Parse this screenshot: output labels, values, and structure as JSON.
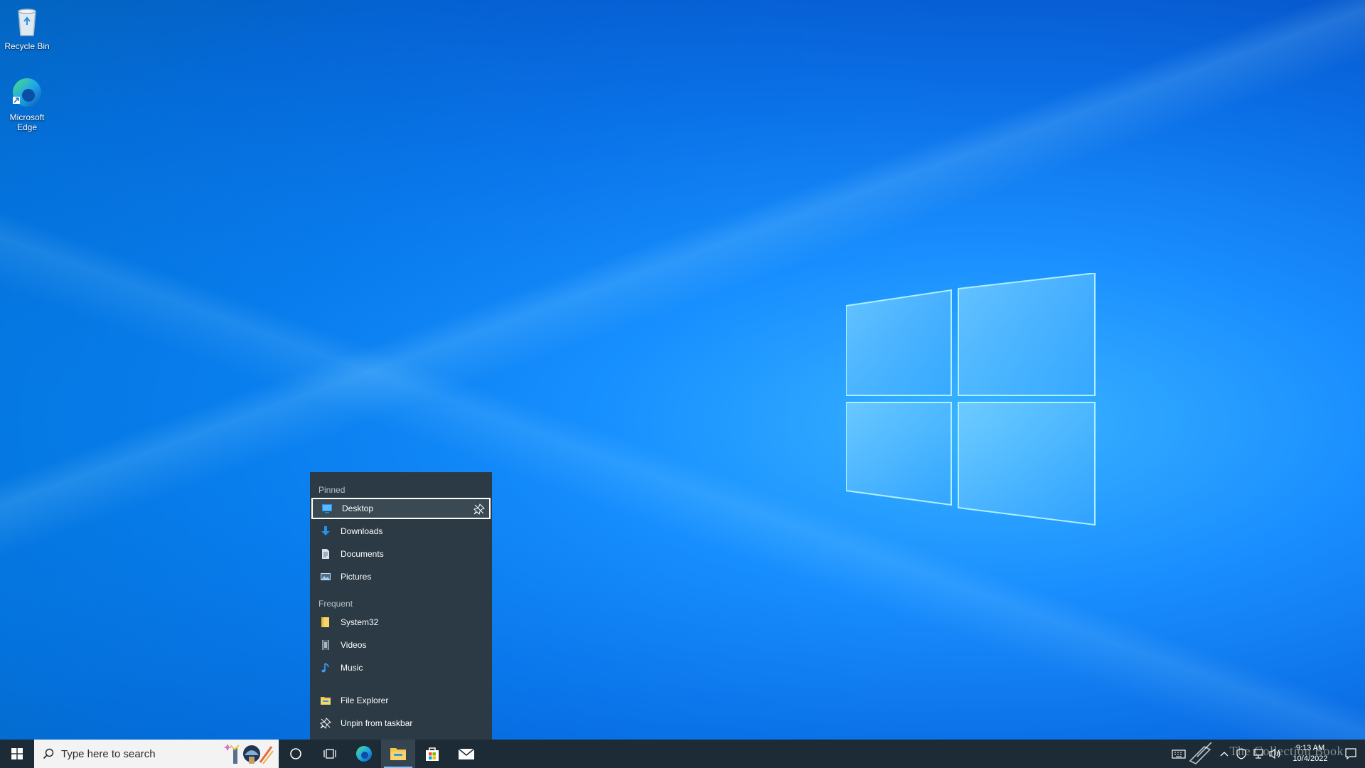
{
  "desktop": {
    "icons": [
      {
        "label": "Recycle Bin"
      },
      {
        "label": "Microsoft Edge"
      }
    ]
  },
  "jumplist": {
    "pinned_header": "Pinned",
    "pinned": [
      {
        "label": "Desktop",
        "icon": "desktop-folder-icon"
      },
      {
        "label": "Downloads",
        "icon": "downloads-arrow-icon"
      },
      {
        "label": "Documents",
        "icon": "documents-icon"
      },
      {
        "label": "Pictures",
        "icon": "pictures-icon"
      }
    ],
    "frequent_header": "Frequent",
    "frequent": [
      {
        "label": "System32",
        "icon": "folder-icon"
      },
      {
        "label": "Videos",
        "icon": "videos-icon"
      },
      {
        "label": "Music",
        "icon": "music-note-icon"
      }
    ],
    "actions": [
      {
        "label": "File Explorer",
        "icon": "file-explorer-icon"
      },
      {
        "label": "Unpin from taskbar",
        "icon": "unpin-icon"
      }
    ]
  },
  "taskbar": {
    "search_placeholder": "Type here to search",
    "clock_time": "9:13 AM",
    "clock_date": "10/4/2022"
  },
  "watermark": "The Collection Book",
  "colors": {
    "taskbar": "#1c2b35",
    "jumplist": "#2b3a44",
    "accent": "#0078d7"
  }
}
